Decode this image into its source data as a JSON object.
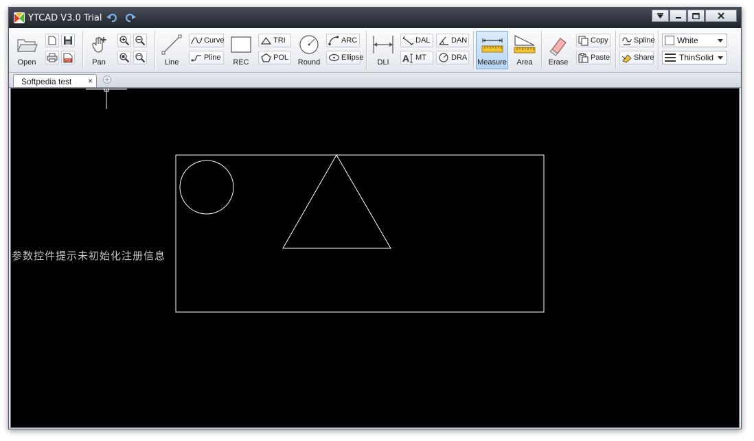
{
  "window": {
    "title": "YTCAD V3.0 Trial"
  },
  "toolbar": {
    "open": "Open",
    "pan": "Pan",
    "line": "Line",
    "curve": "Curve",
    "pline": "Pline",
    "rec": "REC",
    "tri": "TRI",
    "pol": "POL",
    "round": "Round",
    "arc": "ARC",
    "ellipse": "Ellipse",
    "dli": "DLI",
    "dal": "DAL",
    "dan": "DAN",
    "mt": "MT",
    "dra": "DRA",
    "measure": "Measure",
    "area": "Area",
    "erase": "Erase",
    "copy": "Copy",
    "paste": "Paste",
    "spline": "Spline",
    "share": "Share",
    "color_value": "White",
    "linetype_value": "ThinSolid"
  },
  "tabs": [
    {
      "label": "Softpedia test",
      "close": "×"
    }
  ],
  "canvas": {
    "background": "#000000",
    "stroke": "#ffffff",
    "message": "参数控件提示未初始化注册信息"
  },
  "colors": {
    "titlebar": "#2c313a",
    "toolbar": "#eef1f5",
    "active_button": "#c7e0f7",
    "accent_gold": "#e0b020"
  },
  "icons": [
    "app-logo",
    "undo-icon",
    "redo-icon",
    "folder-icon",
    "new-file-icon",
    "save-icon",
    "print-icon",
    "pdf-icon",
    "pan-hand-icon",
    "zoom-in-icon",
    "zoom-out-icon",
    "zoom-window-icon",
    "zoom-refresh-icon",
    "line-icon",
    "rectangle-icon",
    "circle-icon",
    "ruler-icon",
    "area-icon",
    "eraser-icon",
    "copy-icon",
    "paste-icon",
    "spline-icon",
    "share-icon"
  ]
}
